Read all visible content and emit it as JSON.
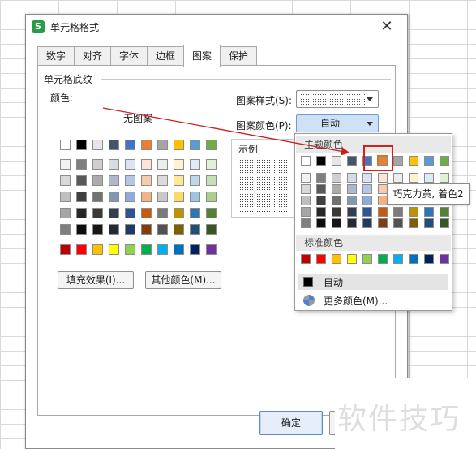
{
  "dialog": {
    "title": "单元格格式",
    "app_icon_glyph": "S",
    "close_glyph": "✕",
    "tabs": [
      {
        "label": "数字"
      },
      {
        "label": "对齐"
      },
      {
        "label": "字体"
      },
      {
        "label": "边框"
      },
      {
        "label": "图案",
        "active": true
      },
      {
        "label": "保护"
      }
    ],
    "section_title": "单元格底纹",
    "color_label": "颜色:",
    "no_pattern": "无图案",
    "pattern_style_label": "图案样式(S):",
    "pattern_color_label": "图案颜色(P):",
    "pattern_color_value": "自动",
    "sample_label": "示例",
    "fill_effects_button": "填充效果(I)...",
    "other_colors_button": "其他颜色(M)...",
    "ok_button": "确定"
  },
  "palette": {
    "top_row": [
      "#ffffff",
      "#000000",
      "#e7e6e6",
      "#44546a",
      "#4472c4",
      "#ed7d31",
      "#a5a5a5",
      "#ffc000",
      "#5b9bd5",
      "#70ad47"
    ],
    "shade_rows": [
      [
        "#f2f2f2",
        "#7f7f7f",
        "#d0cece",
        "#d6dce5",
        "#dae3f3",
        "#fbe5d6",
        "#ededed",
        "#fff2cc",
        "#deebf7",
        "#e2f0d9"
      ],
      [
        "#d9d9d9",
        "#595959",
        "#aeabab",
        "#adb9ca",
        "#b4c7e7",
        "#f8cbad",
        "#dbdbdb",
        "#ffe699",
        "#bdd7ee",
        "#c5e0b4"
      ],
      [
        "#bfbfbf",
        "#404040",
        "#757171",
        "#8497b0",
        "#8faadc",
        "#f4b183",
        "#c9c9c9",
        "#ffd966",
        "#9dc3e6",
        "#a9d18e"
      ],
      [
        "#a6a6a6",
        "#262626",
        "#3b3838",
        "#333f50",
        "#2f5597",
        "#c55a11",
        "#7b7b7b",
        "#bf9000",
        "#2e75b6",
        "#548235"
      ],
      [
        "#7f7f7f",
        "#0d0d0d",
        "#171515",
        "#222a35",
        "#1f3864",
        "#843c0c",
        "#525252",
        "#7f6000",
        "#1f4e79",
        "#385723"
      ]
    ],
    "standard_row": [
      "#c00000",
      "#ff0000",
      "#ffc000",
      "#ffff00",
      "#92d050",
      "#00b050",
      "#00b0f0",
      "#0070c0",
      "#002060",
      "#7030a0"
    ]
  },
  "popup": {
    "theme_header": "主题颜色",
    "standard_header": "标准颜色",
    "auto_label": "自动",
    "more_colors_label": "更多颜色(M)...",
    "hover_tooltip": "巧克力黄, 着色2",
    "highlighted_color": "#ed7d31"
  },
  "watermark": "软件技巧"
}
